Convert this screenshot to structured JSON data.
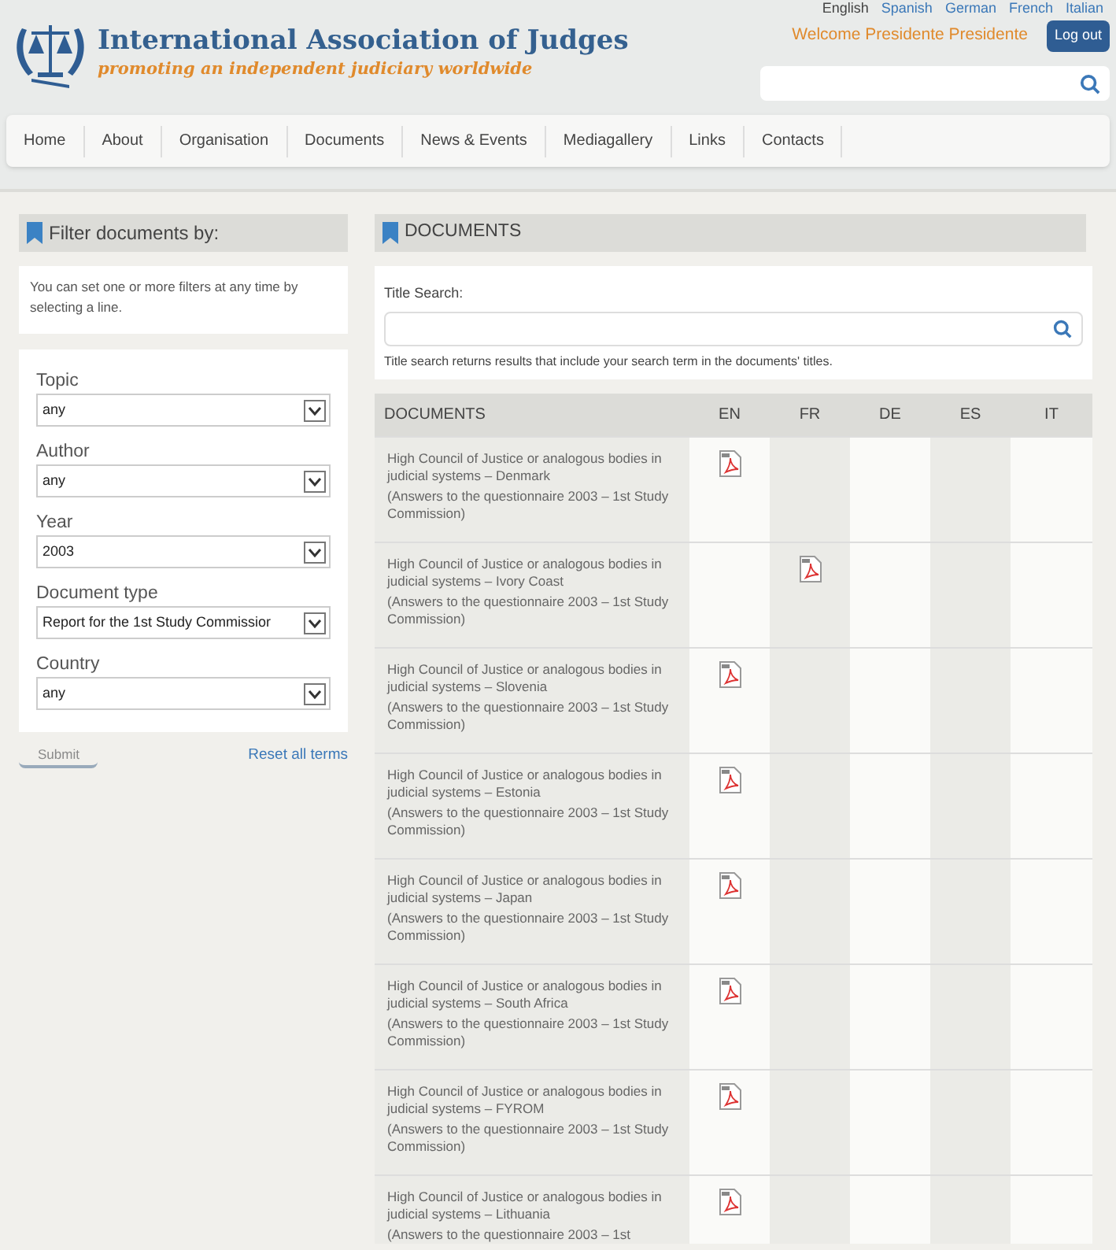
{
  "languages": [
    "English",
    "Spanish",
    "German",
    "French",
    "Italian"
  ],
  "site": {
    "title": "International Association of Judges",
    "tagline": "promoting an independent judiciary worldwide"
  },
  "welcome": "Welcome Presidente Presidente",
  "logout": "Log out",
  "nav": [
    "Home",
    "About",
    "Organisation",
    "Documents",
    "News & Events",
    "Mediagallery",
    "Links",
    "Contacts"
  ],
  "filter": {
    "title": "Filter documents by:",
    "intro": "You can set one or more filters at any time by selecting a line.",
    "fields": [
      {
        "label": "Topic",
        "value": "any"
      },
      {
        "label": "Author",
        "value": "any"
      },
      {
        "label": "Year",
        "value": "2003"
      },
      {
        "label": "Document type",
        "value": "Report for the 1st Study Commissior"
      },
      {
        "label": "Country",
        "value": "any"
      }
    ],
    "submit": "Submit",
    "reset": "Reset all terms"
  },
  "documents": {
    "title": "DOCUMENTS",
    "search_label": "Title Search:",
    "search_hint": "Title search returns results that include your search term in the documents' titles.",
    "columns": [
      "DOCUMENTS",
      "EN",
      "FR",
      "DE",
      "ES",
      "IT"
    ],
    "rows": [
      {
        "title": "High Council of Justice or analogous bodies in judicial systems – Denmark",
        "note": "(Answers to the questionnaire 2003 – 1st Study Commission)",
        "pdf": [
          true,
          false,
          false,
          false,
          false
        ]
      },
      {
        "title": "High Council of Justice or analogous bodies in judicial systems – Ivory Coast",
        "note": "(Answers to the questionnaire 2003 – 1st Study Commission)",
        "pdf": [
          false,
          true,
          false,
          false,
          false
        ]
      },
      {
        "title": "High Council of Justice or analogous bodies in judicial systems – Slovenia",
        "note": "(Answers to the questionnaire 2003 – 1st Study Commission)",
        "pdf": [
          true,
          false,
          false,
          false,
          false
        ]
      },
      {
        "title": "High Council of Justice or analogous bodies in judicial systems – Estonia",
        "note": "(Answers to the questionnaire 2003 – 1st Study Commission)",
        "pdf": [
          true,
          false,
          false,
          false,
          false
        ]
      },
      {
        "title": "High Council of Justice or analogous bodies in judicial systems – Japan",
        "note": "(Answers to the questionnaire 2003 – 1st Study Commission)",
        "pdf": [
          true,
          false,
          false,
          false,
          false
        ]
      },
      {
        "title": "High Council of Justice or analogous bodies in judicial systems – South Africa",
        "note": "(Answers to the questionnaire 2003 – 1st Study Commission)",
        "pdf": [
          true,
          false,
          false,
          false,
          false
        ]
      },
      {
        "title": "High Council of Justice or analogous bodies in judicial systems – FYROM",
        "note": "(Answers to the questionnaire 2003 – 1st Study Commission)",
        "pdf": [
          true,
          false,
          false,
          false,
          false
        ]
      },
      {
        "title": "High Council of Justice or analogous bodies in judicial systems – Lithuania",
        "note": "(Answers to the questionnaire 2003 – 1st",
        "pdf": [
          true,
          false,
          false,
          false,
          false
        ]
      }
    ]
  }
}
